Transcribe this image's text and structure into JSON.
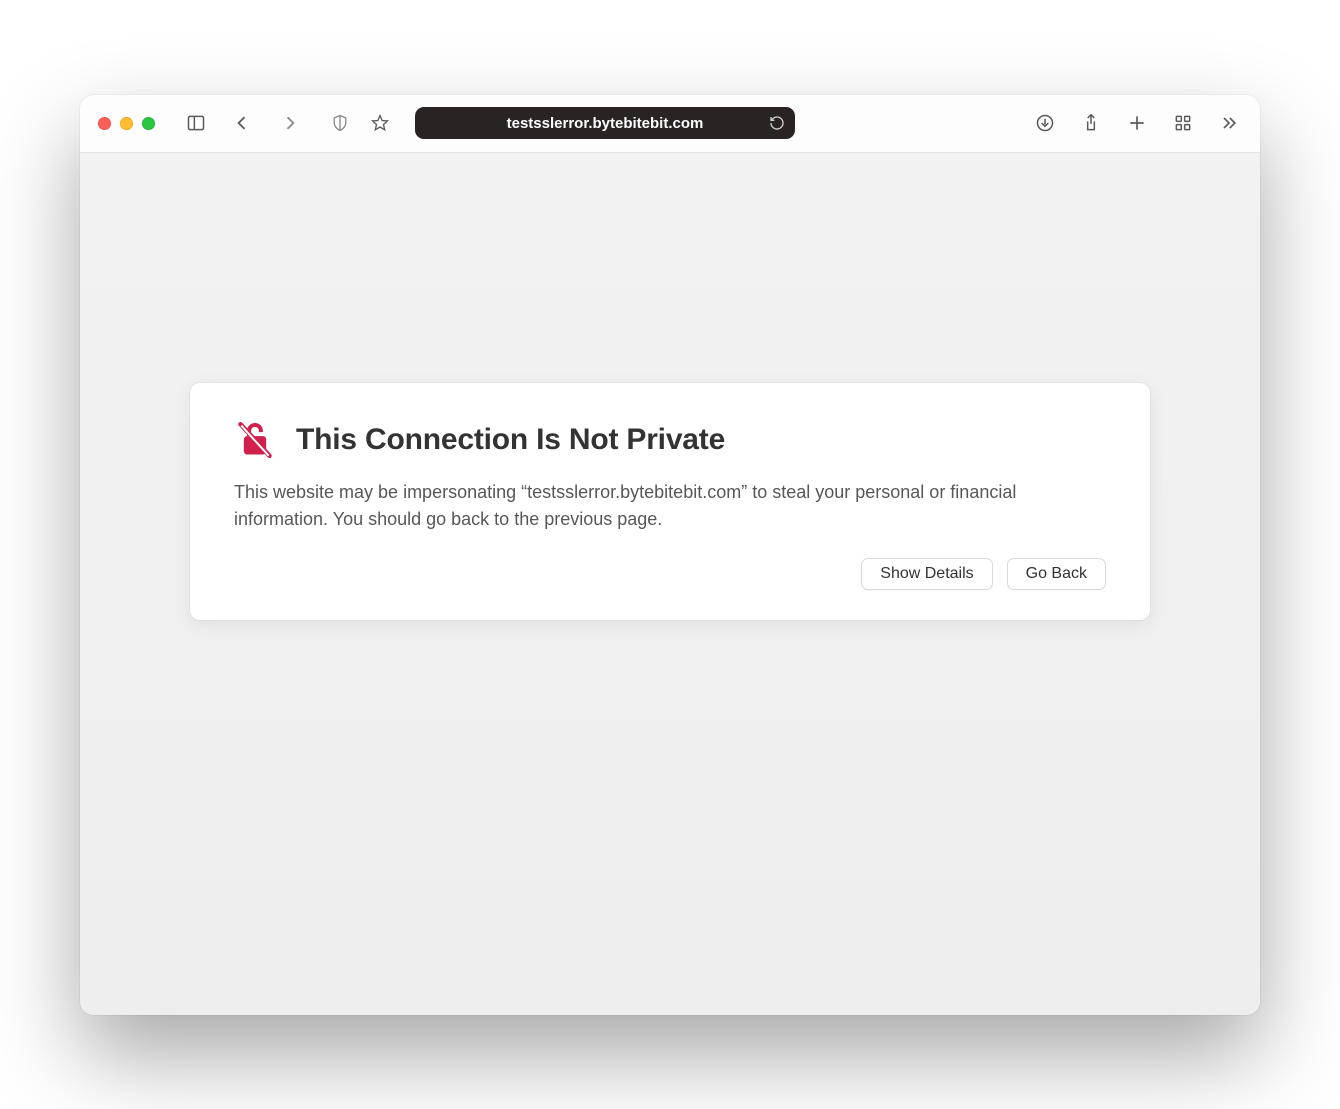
{
  "toolbar": {
    "url": "testsslerror.bytebitebit.com"
  },
  "error": {
    "title": "This Connection Is Not Private",
    "body": "This website may be impersonating “testsslerror.bytebitebit.com” to steal your personal or financial information. You should go back to the previous page.",
    "show_details_label": "Show Details",
    "go_back_label": "Go Back"
  },
  "colors": {
    "warning_red": "#d1204b"
  }
}
